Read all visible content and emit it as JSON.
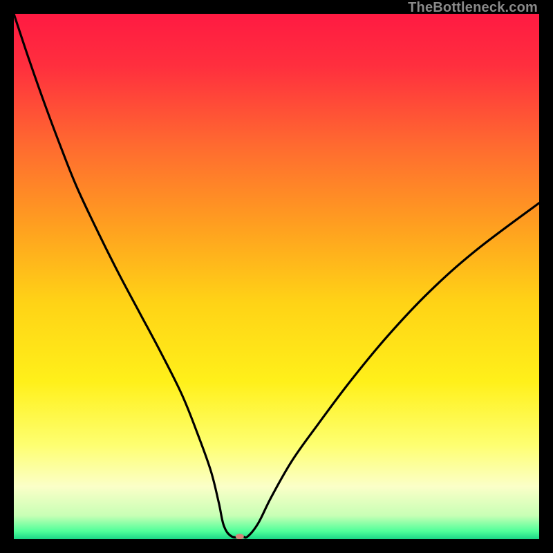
{
  "watermark": "TheBottleneck.com",
  "chart_data": {
    "type": "line",
    "title": "",
    "xlabel": "",
    "ylabel": "",
    "xlim": [
      0,
      100
    ],
    "ylim": [
      0,
      100
    ],
    "background_gradient": {
      "stops": [
        {
          "offset": 0.0,
          "color": "#ff1a42"
        },
        {
          "offset": 0.1,
          "color": "#ff2f3e"
        },
        {
          "offset": 0.25,
          "color": "#ff6a30"
        },
        {
          "offset": 0.4,
          "color": "#ff9e20"
        },
        {
          "offset": 0.55,
          "color": "#ffd316"
        },
        {
          "offset": 0.7,
          "color": "#fff01a"
        },
        {
          "offset": 0.82,
          "color": "#feff70"
        },
        {
          "offset": 0.9,
          "color": "#fbffc8"
        },
        {
          "offset": 0.955,
          "color": "#c8ffb5"
        },
        {
          "offset": 0.985,
          "color": "#4fff9a"
        },
        {
          "offset": 1.0,
          "color": "#1bd686"
        }
      ]
    },
    "series": [
      {
        "name": "bottleneck-curve",
        "x": [
          0.0,
          3.0,
          6.0,
          9.0,
          12.0,
          16.0,
          20.0,
          24.0,
          28.0,
          32.0,
          35.0,
          37.5,
          39.0,
          40.0,
          41.5,
          43.5,
          44.5,
          46.5,
          49.0,
          53.0,
          58.0,
          64.0,
          71.0,
          79.0,
          88.0,
          100.0
        ],
        "y": [
          100.0,
          91.0,
          82.5,
          74.5,
          67.0,
          58.5,
          50.5,
          43.0,
          35.5,
          27.5,
          20.0,
          13.0,
          7.0,
          2.5,
          0.5,
          0.5,
          0.5,
          3.0,
          8.0,
          15.0,
          22.0,
          30.0,
          38.5,
          47.0,
          55.0,
          64.0
        ]
      }
    ],
    "marker": {
      "x": 43.0,
      "y": 0.5,
      "color": "#d6857a",
      "rx": 6,
      "ry": 4
    }
  }
}
